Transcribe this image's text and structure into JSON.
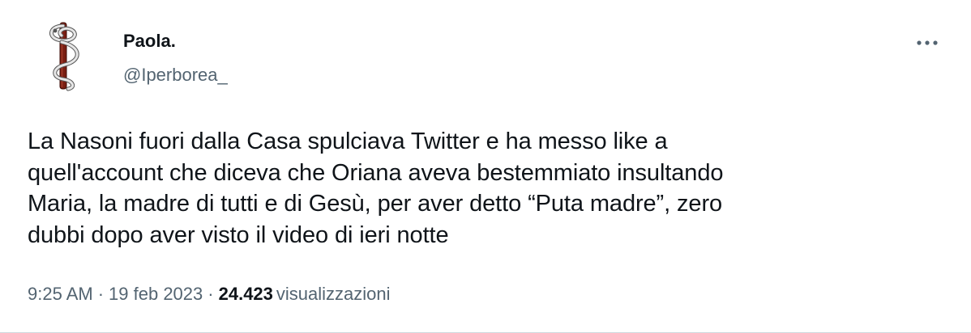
{
  "author": {
    "display_name": "Paola.",
    "handle": "@Iperborea_",
    "avatar_icon": "caduceus-snake-staff-icon"
  },
  "menu": {
    "icon": "more-horizontal-icon"
  },
  "tweet": {
    "text": "La Nasoni fuori dalla Casa spulciava Twitter e ha messo like a\nquell'account che diceva che Oriana aveva bestemmiato insultando\nMaria, la madre di tutti e di Gesù, per aver detto “Puta madre”, zero\ndubbi dopo aver visto il video di ieri notte"
  },
  "meta": {
    "time": "9:25 AM",
    "separator": "·",
    "date": "19 feb 2023",
    "views_count": "24.423",
    "views_label": "visualizzazioni"
  },
  "colors": {
    "text_primary": "#0f1419",
    "text_secondary": "#536471",
    "staff": "#7a1e12",
    "snake": "#d9d9d9"
  }
}
